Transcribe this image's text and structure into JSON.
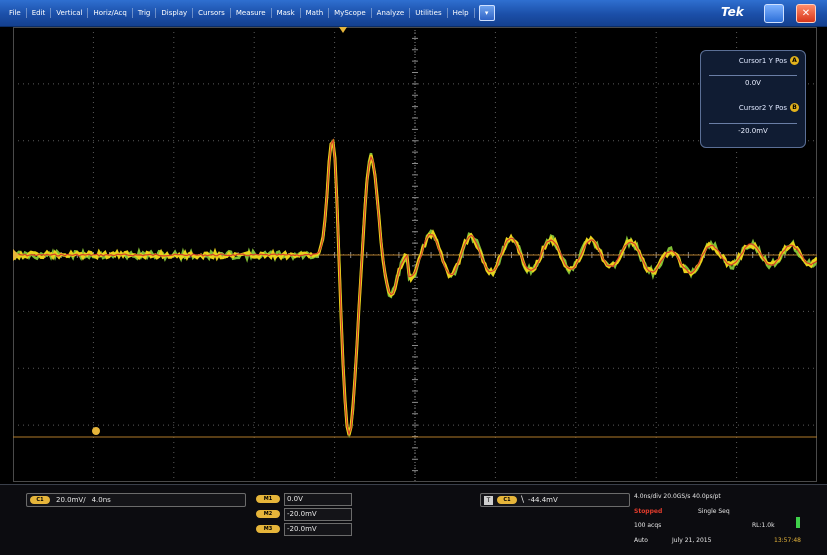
{
  "menubar": {
    "items": [
      "File",
      "Edit",
      "Vertical",
      "Horiz/Acq",
      "Trig",
      "Display",
      "Cursors",
      "Measure",
      "Mask",
      "Math",
      "MyScope",
      "Analyze",
      "Utilities",
      "Help"
    ],
    "help_button": "▾",
    "brand": "Tek",
    "minimize": "",
    "close": "✕"
  },
  "position_panel": {
    "row1_label": "Cursor1 Y Pos",
    "row1_badge": "A",
    "row1_value": "0.0V",
    "row2_label": "Cursor2 Y Pos",
    "row2_badge": "B",
    "row2_value": "-20.0mV"
  },
  "bottom": {
    "channel": {
      "badge": "C1",
      "scale": "20.0mV/",
      "offset": "4.0ns"
    },
    "math_rows": [
      {
        "badge": "M1",
        "value": "0.0V"
      },
      {
        "badge": "M2",
        "value": "-20.0mV"
      },
      {
        "badge": "M3",
        "value": "-20.0mV"
      }
    ],
    "trigger": {
      "icon": "T",
      "badge": "C1",
      "slope": "\\",
      "level": "-44.4mV"
    },
    "acquisition": {
      "line1": "4.0ns/div   20.0GS/s   40.0ps/pt",
      "status": "Stopped",
      "mode": "Single Seq",
      "acqs": "100 acqs",
      "rl": "RL:1.0k",
      "auto": "Auto",
      "date": "July 21, 2015",
      "time": "13:57:48"
    }
  },
  "colors": {
    "waveform_yellow": "#e8d31c",
    "waveform_green": "#8fd43b",
    "waveform_red": "#d8402a",
    "cursor_color": "#b07a2a",
    "menubar_blue": "#1b4fa8"
  }
}
